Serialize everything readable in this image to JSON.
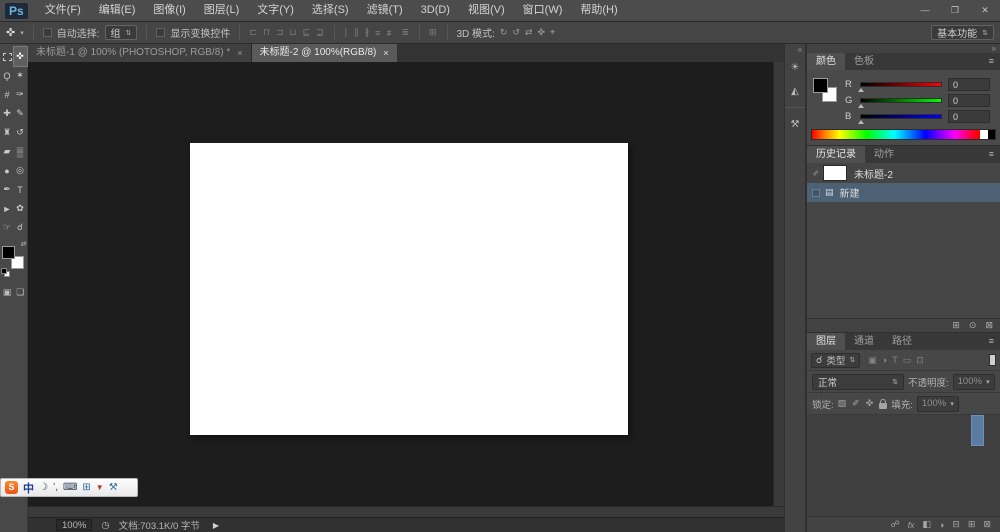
{
  "app": {
    "logo": "Ps",
    "workspace": "基本功能"
  },
  "window": {
    "minimize": "—",
    "restore": "❐",
    "close": "✕"
  },
  "menu": {
    "items": [
      "文件(F)",
      "编辑(E)",
      "图像(I)",
      "图层(L)",
      "文字(Y)",
      "选择(S)",
      "滤镜(T)",
      "3D(D)",
      "视图(V)",
      "窗口(W)",
      "帮助(H)"
    ]
  },
  "options": {
    "move_tool_icon": "✜",
    "dropdown_arrow": "▾",
    "spin_arrow": "⇅",
    "auto_select_label": "自动选择:",
    "auto_select_value": "组",
    "show_transform_label": "显示变换控件",
    "align_icons": [
      "⊏",
      "⊓",
      "⊐",
      "⊔",
      "⊑",
      "⊒"
    ],
    "distribute_icons": [
      "∣",
      "∥",
      "∦",
      "≡",
      "≢",
      "≣"
    ],
    "auto_align_icon": "⊞",
    "mode3d_label": "3D 模式:",
    "mode3d_icons": [
      "↻",
      "↺",
      "⇄",
      "✜",
      "⌖"
    ]
  },
  "tabs": {
    "doc1": "未标题-1 @ 100% (PHOTOSHOP, RGB/8) *",
    "doc1_close": "×",
    "doc2": "未标题-2 @ 100%(RGB/8)",
    "doc2_close": "×"
  },
  "tools": {
    "list": [
      {
        "name": "rectangular-marquee-tool",
        "glyph": ""
      },
      {
        "name": "move-tool",
        "glyph": "✜"
      },
      {
        "name": "lasso-tool",
        "glyph": "Ϙ"
      },
      {
        "name": "magic-wand-tool",
        "glyph": "✶"
      },
      {
        "name": "crop-tool",
        "glyph": "#"
      },
      {
        "name": "eyedropper-tool",
        "glyph": "✑"
      },
      {
        "name": "healing-brush-tool",
        "glyph": "✚"
      },
      {
        "name": "brush-tool",
        "glyph": "✎"
      },
      {
        "name": "clone-stamp-tool",
        "glyph": "♜"
      },
      {
        "name": "history-brush-tool",
        "glyph": "↺"
      },
      {
        "name": "eraser-tool",
        "glyph": "▰"
      },
      {
        "name": "gradient-tool",
        "glyph": "▒"
      },
      {
        "name": "blur-tool",
        "glyph": "●"
      },
      {
        "name": "dodge-tool",
        "glyph": "◎"
      },
      {
        "name": "pen-tool",
        "glyph": "✒"
      },
      {
        "name": "type-tool",
        "glyph": "T"
      },
      {
        "name": "path-selection-tool",
        "glyph": "►"
      },
      {
        "name": "custom-shape-tool",
        "glyph": "✿"
      },
      {
        "name": "hand-tool",
        "glyph": "☞"
      },
      {
        "name": "zoom-tool",
        "glyph": "☌"
      }
    ],
    "swap_icon": "⇄",
    "quick_mask_icon": "▣",
    "screen_mode_icon": "❏"
  },
  "dock": {
    "collapse_icon": "«",
    "adjustments_icon": "☀",
    "styles_icon": "◭",
    "presets_icon": "⚒"
  },
  "panels_top": {
    "collapse_icon": "»"
  },
  "color": {
    "tab_active": "颜色",
    "tab_inactive": "色板",
    "menu_icon": "≡",
    "channels": [
      {
        "label": "R",
        "value": "0"
      },
      {
        "label": "G",
        "value": "0"
      },
      {
        "label": "B",
        "value": "0"
      }
    ]
  },
  "history": {
    "tab_active": "历史记录",
    "tab_inactive": "动作",
    "menu_icon": "≡",
    "source_icon": "✐",
    "snapshot_label": "未标题-2",
    "step_icon": "▤",
    "step_label": "新建",
    "new_doc_icon": "⊞",
    "snapshot_icon": "⊙",
    "delete_icon": "⊠"
  },
  "layers": {
    "tab_layers": "图层",
    "tab_channels": "通道",
    "tab_paths": "路径",
    "menu_icon": "≡",
    "search_icon": "☌",
    "filter_label": "类型",
    "filter_icons": [
      "▣",
      "◑",
      "T",
      "▭",
      "⊡"
    ],
    "blend_mode": "正常",
    "opacity_label": "不透明度:",
    "opacity_value": "100%",
    "lock_label": "锁定:",
    "lock_icons": [
      "▨",
      "✐",
      "✜"
    ],
    "fill_label": "填充:",
    "fill_value": "100%",
    "footer_icons": [
      "☍",
      "fx",
      "◧",
      "◑",
      "⊟",
      "⊞",
      "⊠"
    ]
  },
  "status": {
    "zoom": "100%",
    "clock_icon": "◷",
    "doc_info": "文档:703.1K/0 字节",
    "flyout": "▶"
  },
  "ime": {
    "logo": "S",
    "mode": "中",
    "moon": "☽",
    "punct": "’,",
    "keyboard": "⌨",
    "toolbox": "⊞",
    "skin": "▼",
    "wrench": "⚒"
  }
}
